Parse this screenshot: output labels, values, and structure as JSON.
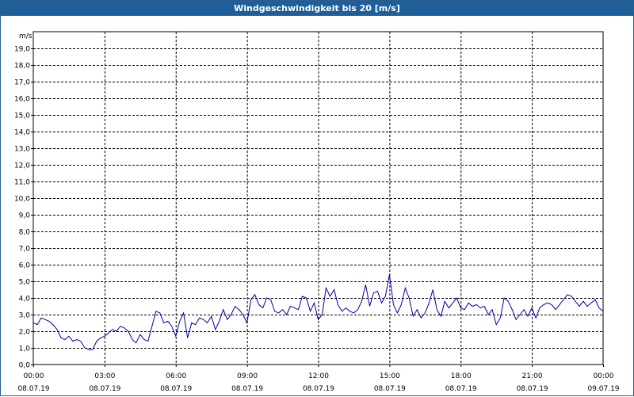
{
  "title": "Windgeschwindigkeit bis 20 [m/s]",
  "colors": {
    "titlebar": "#1f5f99",
    "line": "#0000a0",
    "grid": "#000000"
  },
  "chart_data": {
    "type": "line",
    "title": "Windgeschwindigkeit bis 20 [m/s]",
    "ylabel": "m/s",
    "xlabel": "",
    "ylim": [
      0,
      20
    ],
    "xlim": [
      0,
      24
    ],
    "grid": true,
    "y_ticks": [
      "0,0",
      "1,0",
      "2,0",
      "3,0",
      "4,0",
      "5,0",
      "6,0",
      "7,0",
      "8,0",
      "9,0",
      "10,0",
      "11,0",
      "12,0",
      "13,0",
      "14,0",
      "15,0",
      "16,0",
      "17,0",
      "18,0",
      "19,0"
    ],
    "x_ticks": [
      {
        "time": "00:00",
        "date": "08.07.19"
      },
      {
        "time": "03:00",
        "date": "08.07.19"
      },
      {
        "time": "06:00",
        "date": "08.07.19"
      },
      {
        "time": "09:00",
        "date": "08.07.19"
      },
      {
        "time": "12:00",
        "date": "08.07.19"
      },
      {
        "time": "15:00",
        "date": "08.07.19"
      },
      {
        "time": "18:00",
        "date": "08.07.19"
      },
      {
        "time": "21:00",
        "date": "08.07.19"
      },
      {
        "time": "00:00",
        "date": "09.07.19"
      }
    ],
    "series": [
      {
        "x": [
          0,
          0.17,
          0.33,
          0.5,
          0.67,
          0.83,
          1,
          1.17,
          1.33,
          1.5,
          1.67,
          1.83,
          2,
          2.17,
          2.33,
          2.5,
          2.67,
          2.83,
          3,
          3.17,
          3.33,
          3.5,
          3.67,
          3.83,
          4,
          4.17,
          4.33,
          4.5,
          4.67,
          4.83,
          5,
          5.17,
          5.33,
          5.5,
          5.67,
          5.83,
          6,
          6.17,
          6.33,
          6.5,
          6.67,
          6.83,
          7,
          7.17,
          7.33,
          7.5,
          7.67,
          7.83,
          8,
          8.17,
          8.33,
          8.5,
          8.67,
          8.83,
          9,
          9.17,
          9.33,
          9.5,
          9.67,
          9.83,
          10,
          10.17,
          10.33,
          10.5,
          10.67,
          10.83,
          11,
          11.17,
          11.33,
          11.5,
          11.67,
          11.83,
          12,
          12.17,
          12.33,
          12.5,
          12.67,
          12.83,
          13,
          13.17,
          13.33,
          13.5,
          13.67,
          13.83,
          14,
          14.17,
          14.33,
          14.5,
          14.67,
          14.83,
          15,
          15.17,
          15.33,
          15.5,
          15.67,
          15.83,
          16,
          16.17,
          16.33,
          16.5,
          16.67,
          16.83,
          17,
          17.17,
          17.33,
          17.5,
          17.67,
          17.83,
          18,
          18.17,
          18.33,
          18.5,
          18.67,
          18.83,
          19,
          19.17,
          19.33,
          19.5,
          19.67,
          19.83,
          20,
          20.17,
          20.33,
          20.5,
          20.67,
          20.83,
          21,
          21.17,
          21.33,
          21.5,
          21.67,
          21.83,
          22,
          22.17,
          22.33,
          22.5,
          22.67,
          22.83,
          23,
          23.17,
          23.33,
          23.5,
          23.67,
          23.83,
          24
        ],
        "y": [
          2.5,
          2.4,
          2.8,
          2.7,
          2.6,
          2.4,
          2.1,
          1.6,
          1.5,
          1.7,
          1.4,
          1.5,
          1.4,
          1.0,
          0.9,
          0.9,
          1.4,
          1.6,
          1.7,
          1.9,
          2.1,
          2.0,
          2.3,
          2.2,
          2.0,
          1.5,
          1.3,
          1.8,
          1.5,
          1.4,
          2.3,
          3.2,
          3.1,
          2.5,
          2.6,
          2.3,
          1.7,
          2.6,
          3.1,
          1.6,
          2.5,
          2.4,
          2.8,
          2.7,
          2.5,
          2.9,
          2.1,
          2.6,
          3.3,
          2.7,
          3.0,
          3.5,
          3.3,
          3.0,
          2.5,
          3.9,
          4.2,
          3.6,
          3.4,
          4.0,
          3.9,
          3.2,
          3.1,
          3.3,
          3.0,
          3.5,
          3.4,
          3.3,
          4.1,
          4.0,
          3.2,
          3.7,
          2.7,
          3.0,
          4.6,
          4.1,
          4.5,
          3.6,
          3.2,
          3.4,
          3.2,
          3.1,
          3.3,
          3.8,
          4.8,
          3.5,
          4.3,
          4.4,
          3.7,
          4.1,
          5.4,
          3.6,
          3.1,
          3.6,
          4.6,
          4.0,
          2.9,
          3.3,
          2.8,
          3.1,
          3.7,
          4.5,
          3.3,
          2.9,
          3.8,
          3.4,
          3.7,
          4.0,
          3.4,
          3.3,
          3.7,
          3.5,
          3.6,
          3.4,
          3.5,
          3.0,
          3.3,
          2.4,
          2.8,
          4.0,
          3.8,
          3.3,
          2.7,
          3.0,
          3.3,
          2.9,
          3.4,
          2.8,
          3.4,
          3.6,
          3.7,
          3.6,
          3.3,
          3.6,
          3.9,
          4.2,
          4.1,
          3.8,
          3.5,
          3.8,
          3.5,
          3.7,
          3.9,
          3.4,
          3.2
        ]
      }
    ]
  }
}
